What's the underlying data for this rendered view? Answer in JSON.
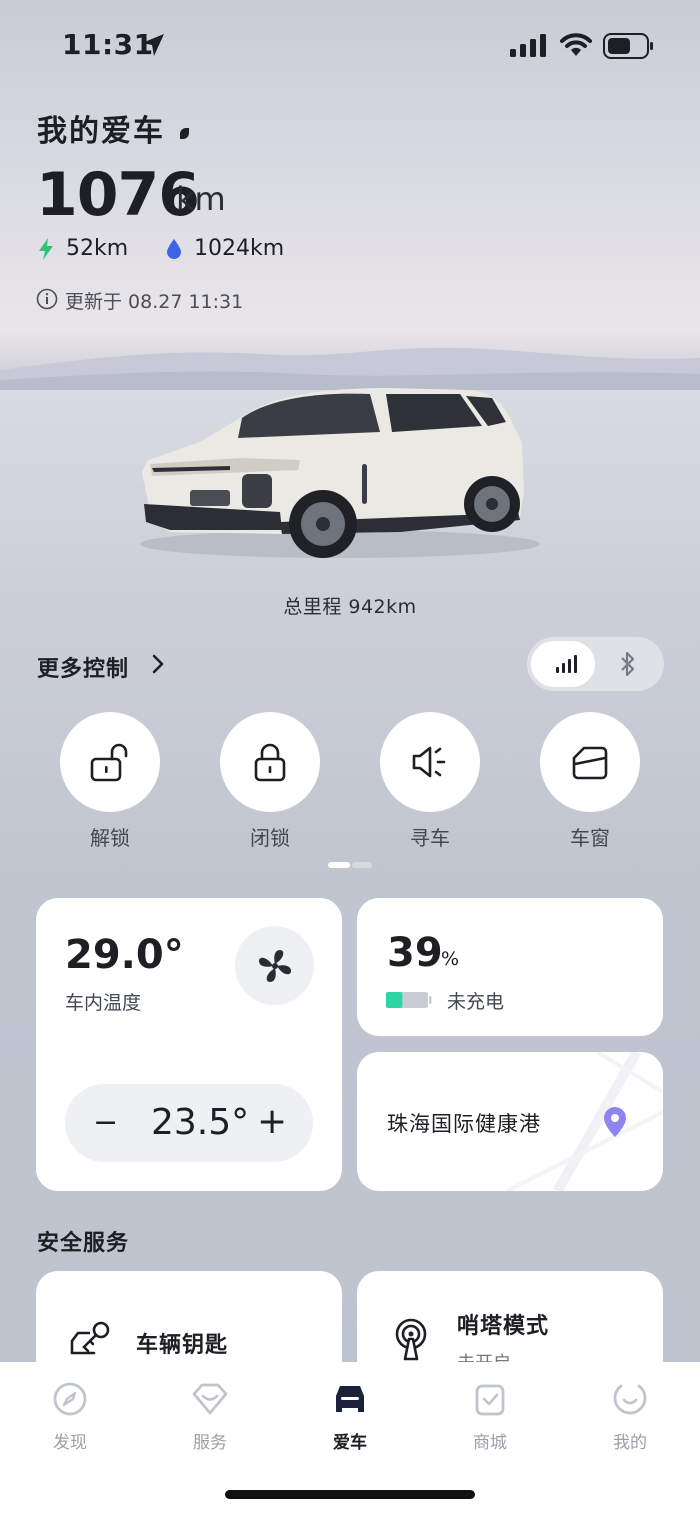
{
  "status_bar": {
    "time": "11:31"
  },
  "header": {
    "title": "我的爱车",
    "range_value": "1076",
    "range_unit": "km",
    "electric_range": "52km",
    "fuel_range": "1024km",
    "updated": "更新于 08.27 11:31"
  },
  "car": {
    "odometer": "总里程 942km"
  },
  "controls": {
    "more_label": "更多控制",
    "connection_mode": "cellular",
    "buttons": [
      {
        "label": "解锁",
        "icon": "unlock-icon"
      },
      {
        "label": "闭锁",
        "icon": "lock-icon"
      },
      {
        "label": "寻车",
        "icon": "horn-icon"
      },
      {
        "label": "车窗",
        "icon": "window-icon"
      }
    ],
    "page_index": 1,
    "page_count": 2
  },
  "climate": {
    "cabin_temp": "29.0°",
    "cabin_label": "车内温度",
    "set_temp": "23.5°",
    "minus": "−",
    "plus": "+"
  },
  "battery": {
    "percent": "39",
    "percent_unit": "%",
    "level": 0.39,
    "status": "未充电",
    "fill_color": "#2fd6a3"
  },
  "location": {
    "name": "珠海国际健康港",
    "pin_color": "#8e86f0"
  },
  "safety": {
    "title": "安全服务",
    "key_label": "车辆钥匙",
    "sentry_label": "哨塔模式",
    "sentry_status": "未开启"
  },
  "tabs": [
    {
      "label": "发现",
      "icon": "compass-icon",
      "active": false
    },
    {
      "label": "服务",
      "icon": "heart-icon",
      "active": false
    },
    {
      "label": "爱车",
      "icon": "car-icon",
      "active": true
    },
    {
      "label": "商城",
      "icon": "shopping-bag-icon",
      "active": false
    },
    {
      "label": "我的",
      "icon": "profile-icon",
      "active": false
    }
  ]
}
